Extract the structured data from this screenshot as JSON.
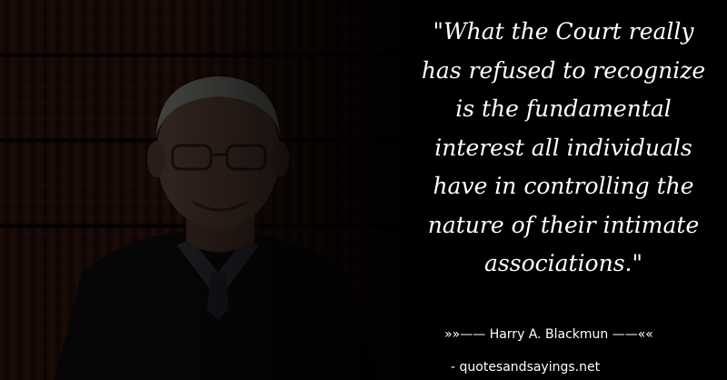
{
  "quote": {
    "text": "\"What the Court really\nhas refused to recognize\nis the fundamental\ninterest all individuals\nhave in controlling the\nnature of their intimate\nassociations.\""
  },
  "attribution": {
    "author_line": "»»—— Harry A. Blackmun ——««"
  },
  "footer": {
    "site": "- quotesandsayings.net"
  },
  "colors": {
    "background": "#000000",
    "text": "#ffffff"
  }
}
